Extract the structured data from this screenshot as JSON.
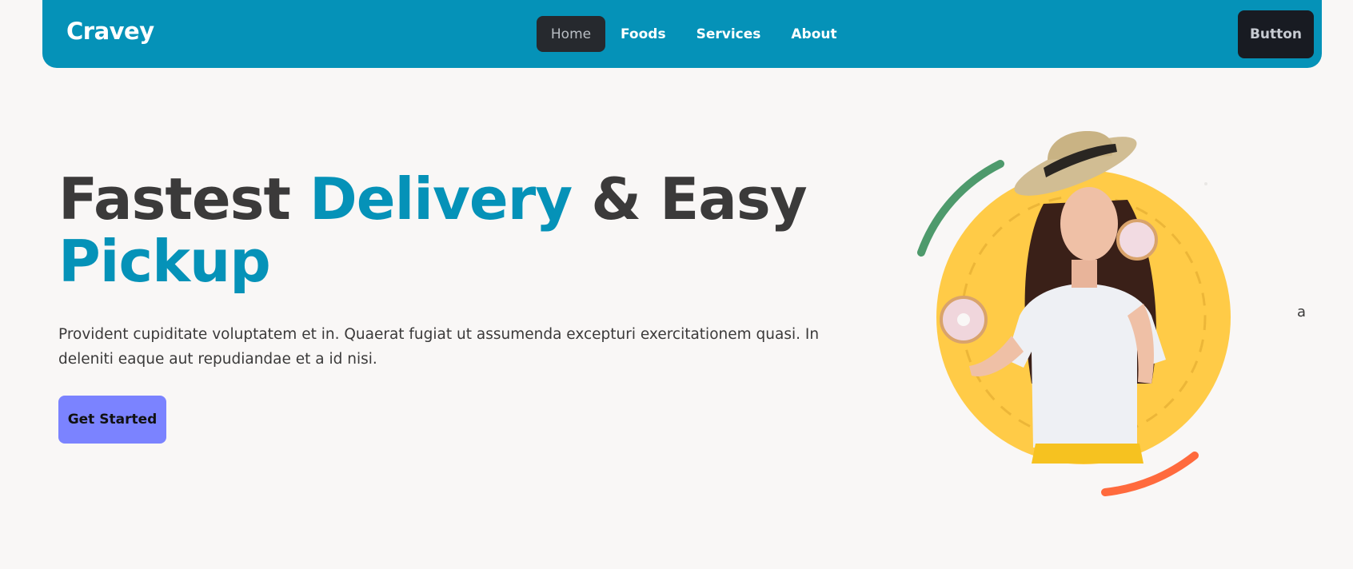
{
  "nav": {
    "brand": "Cravey",
    "links": [
      {
        "label": "Home",
        "active": true
      },
      {
        "label": "Foods"
      },
      {
        "label": "Services"
      },
      {
        "label": "About"
      }
    ],
    "button_label": "Button"
  },
  "hero": {
    "title_part1": "Fastest ",
    "title_accent1": "Delivery",
    "title_part2": " & Easy",
    "title_accent2": "Pickup",
    "description": "Provident cupiditate voluptatem et in. Quaerat fugiat ut assumenda excepturi exercitationem quasi. In deleniti eaque aut repudiandae et a id nisi.",
    "cta_label": "Get Started"
  },
  "stray_text": "a",
  "colors": {
    "primary": "#0592b8",
    "text": "#3b3a3a",
    "background": "#f9f7f6",
    "cta": "#7b83ff",
    "dark_button": "#181b22",
    "circle_yellow": "#ffcb47",
    "arc_green": "#4e9a6c",
    "arc_orange": "#ff6a3d"
  }
}
